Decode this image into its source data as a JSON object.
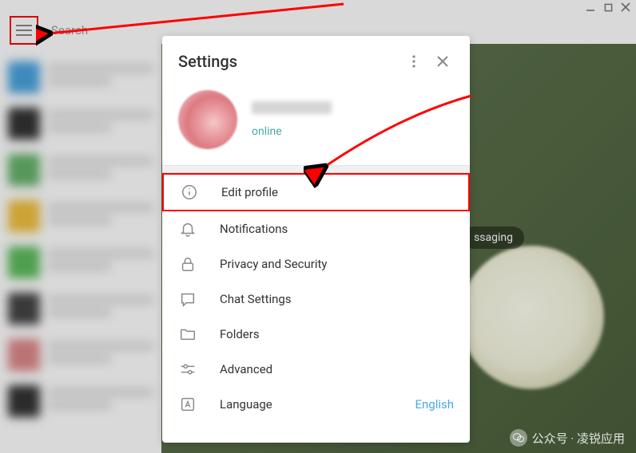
{
  "header": {
    "search_placeholder": "Search"
  },
  "settings": {
    "title": "Settings",
    "profile": {
      "status": "online"
    },
    "menu": [
      {
        "label": "Edit profile",
        "icon": "info-icon"
      },
      {
        "label": "Notifications",
        "icon": "bell-icon"
      },
      {
        "label": "Privacy and Security",
        "icon": "lock-icon"
      },
      {
        "label": "Chat Settings",
        "icon": "chat-icon"
      },
      {
        "label": "Folders",
        "icon": "folder-icon"
      },
      {
        "label": "Advanced",
        "icon": "sliders-icon"
      },
      {
        "label": "Language",
        "icon": "language-icon",
        "value": "English"
      }
    ]
  },
  "content": {
    "bubble_text": "ssaging"
  },
  "watermark": {
    "text": "公众号 · 凌锐应用"
  },
  "colors": {
    "accent": "#4ba8e8",
    "highlight_border": "#ff0000",
    "status_text": "#4ba8a8"
  }
}
